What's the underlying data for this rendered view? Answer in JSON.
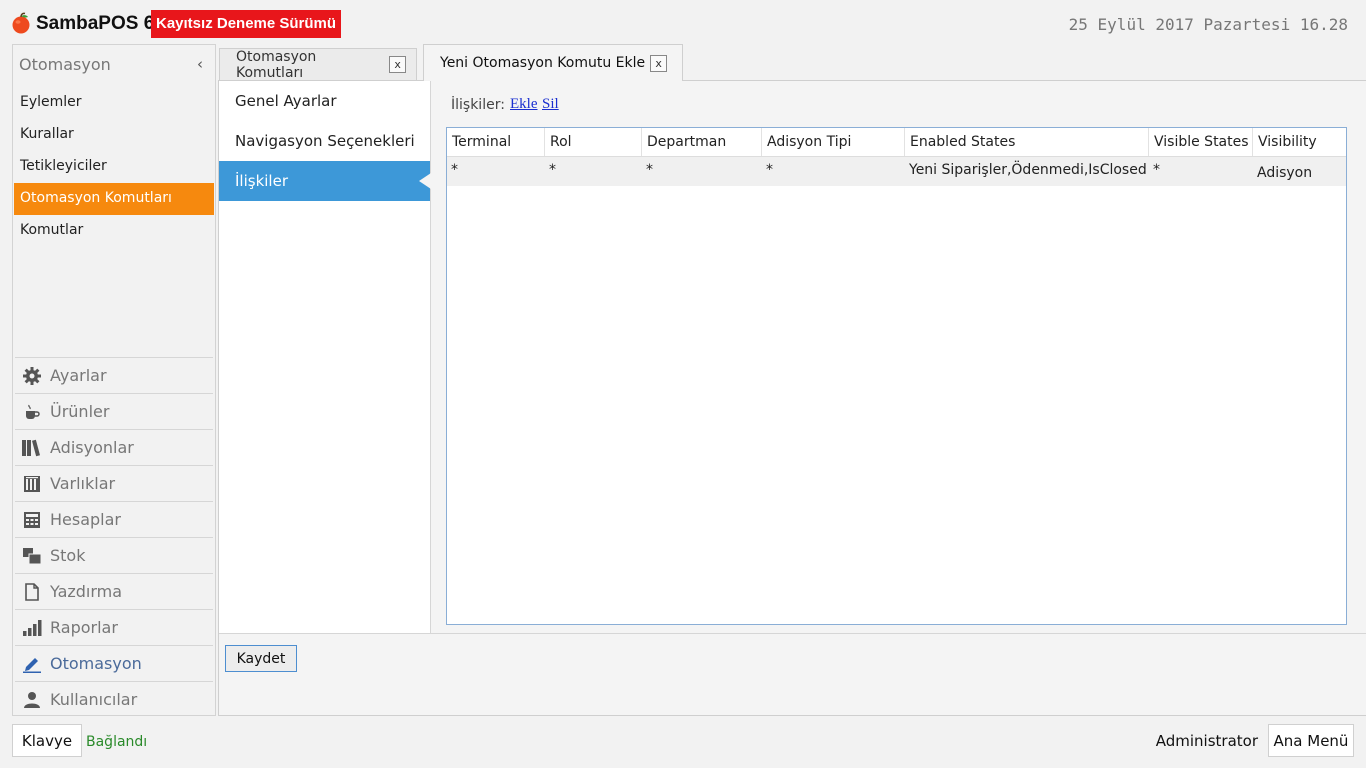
{
  "header": {
    "app_name": "SambaPOS 6",
    "trial_badge": "Kayıtsız Deneme Sürümü",
    "datetime": "25 Eylül 2017 Pazartesi 16.28",
    "logo_color": "#ee4a1e"
  },
  "sidebar": {
    "title": "Otomasyon",
    "collapse_glyph": "‹",
    "sub_items": [
      {
        "label": "Eylemler"
      },
      {
        "label": "Kurallar"
      },
      {
        "label": "Tetikleyiciler"
      },
      {
        "label": "Otomasyon Komutları",
        "active": true
      },
      {
        "label": "Komutlar"
      }
    ],
    "modules": [
      {
        "label": "Ayarlar",
        "icon": "gear-icon"
      },
      {
        "label": "Ürünler",
        "icon": "coffee-cup-icon"
      },
      {
        "label": "Adisyonlar",
        "icon": "books-icon"
      },
      {
        "label": "Varlıklar",
        "icon": "building-icon"
      },
      {
        "label": "Hesaplar",
        "icon": "calculator-icon"
      },
      {
        "label": "Stok",
        "icon": "boxes-icon"
      },
      {
        "label": "Yazdırma",
        "icon": "document-icon"
      },
      {
        "label": "Raporlar",
        "icon": "bar-chart-icon"
      },
      {
        "label": "Otomasyon",
        "icon": "pencil-icon",
        "current": true
      },
      {
        "label": "Kullanıcılar",
        "icon": "user-icon"
      }
    ]
  },
  "tabs": [
    {
      "label": "Otomasyon Komutları",
      "close": "x"
    },
    {
      "label": "Yeni Otomasyon Komutu Ekle",
      "close": "x",
      "active": true
    }
  ],
  "settings_nav": [
    {
      "label": "Genel Ayarlar"
    },
    {
      "label": "Navigasyon Seçenekleri"
    },
    {
      "label": "İlişkiler",
      "active": true
    }
  ],
  "relations": {
    "label": "İlişkiler:",
    "add_link": "Ekle",
    "delete_link": "Sil",
    "columns": [
      "Terminal",
      "Rol",
      "Departman",
      "Adisyon Tipi",
      "Enabled States",
      "Visible States",
      "Visibility"
    ],
    "rows": [
      [
        "*",
        "*",
        "*",
        "*",
        "Yeni Siparişler,Ödenmedi,IsClosed",
        "*",
        "Adisyon"
      ]
    ]
  },
  "footer": {
    "save_label": "Kaydet"
  },
  "status_bar": {
    "keyboard_label": "Klavye",
    "connection": "Bağlandı",
    "user": "Administrator",
    "main_menu_label": "Ana Menü"
  },
  "colors": {
    "accent_orange": "#f6890e",
    "nav_active_blue": "#3d98d8",
    "trial_red": "#e8161b",
    "connected_green": "#2a8a2a"
  }
}
